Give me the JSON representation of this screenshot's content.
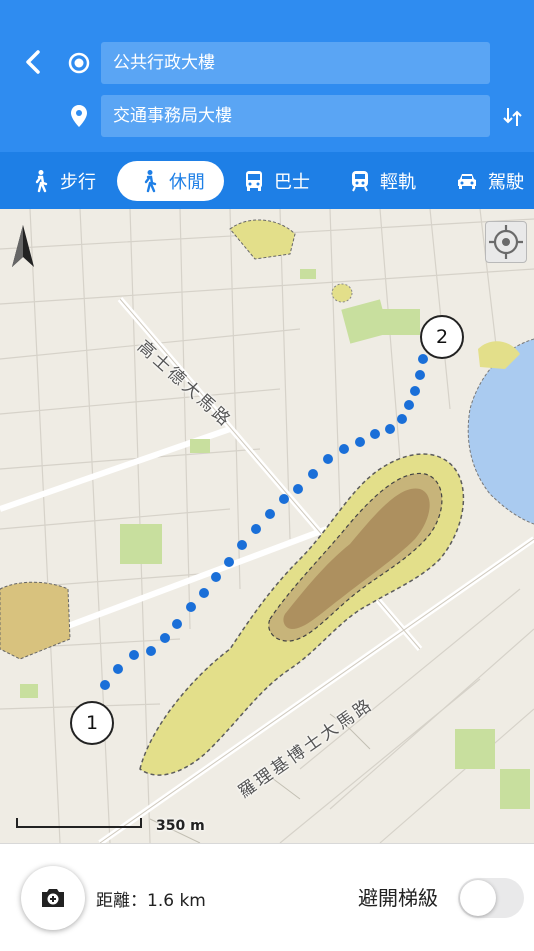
{
  "header": {
    "origin_value": "公共行政大樓",
    "destination_value": "交通事務局大樓"
  },
  "modes": [
    {
      "label": "步行",
      "icon": "walk-icon",
      "active": false
    },
    {
      "label": "休閒",
      "icon": "leisure-walk-icon",
      "active": true
    },
    {
      "label": "巴士",
      "icon": "bus-icon",
      "active": false
    },
    {
      "label": "輕軌",
      "icon": "light-rail-icon",
      "active": false
    },
    {
      "label": "駕駛",
      "icon": "car-icon",
      "active": false
    }
  ],
  "map": {
    "road_labels": [
      "高士德大馬路",
      "羅理基博士大馬路"
    ],
    "scale_label": "350 m",
    "markers": [
      "1",
      "2"
    ]
  },
  "footer": {
    "distance_text": "距離：1.6 km",
    "avoid_stairs_label": "避開梯級",
    "avoid_stairs_on": false
  },
  "colors": {
    "header": "#2f8cf0",
    "modebar": "#1e7fe6",
    "field": "#5aa5f4",
    "route": "#1a6fd8",
    "water": "#aacbf0",
    "park": "#c8df9e"
  }
}
